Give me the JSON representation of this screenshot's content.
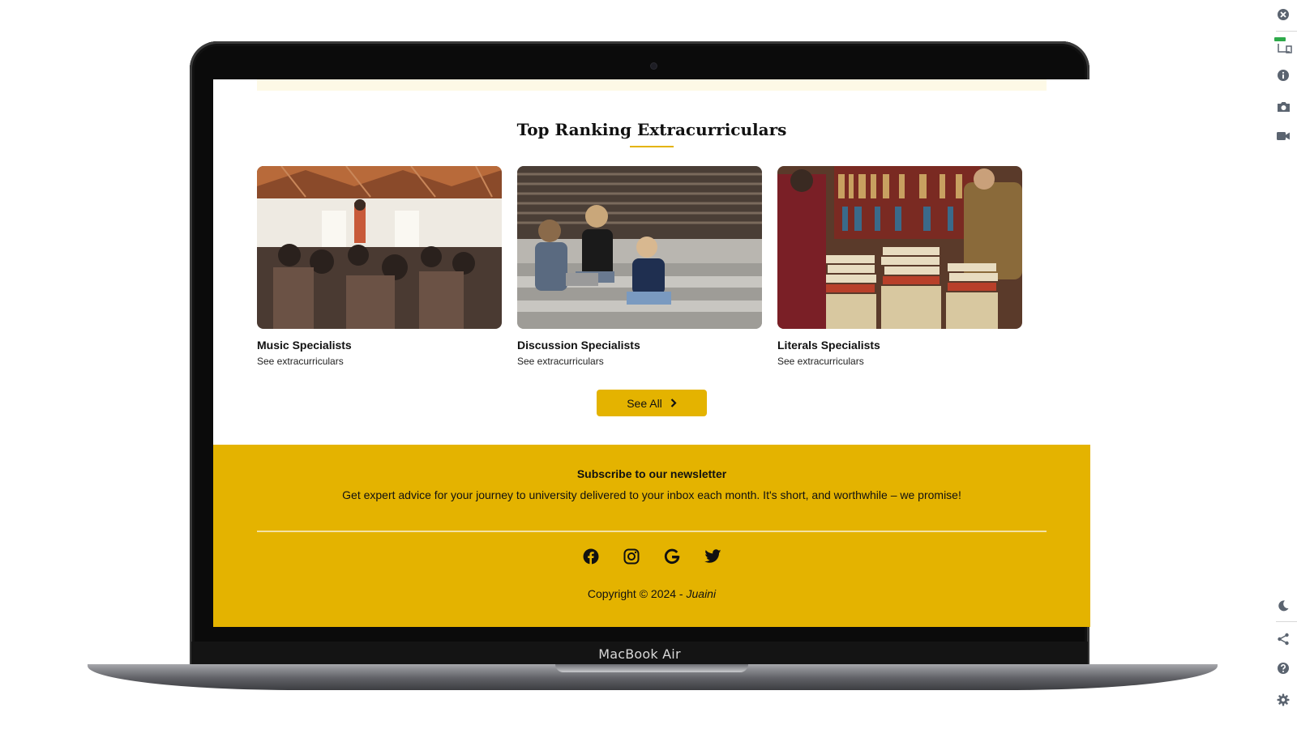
{
  "device": {
    "label": "MacBook Air"
  },
  "section": {
    "title": "Top Ranking Extracurriculars",
    "cards": [
      {
        "title": "Music Specialists",
        "link": "See extracurriculars",
        "image": "students-in-study-hall"
      },
      {
        "title": "Discussion Specialists",
        "link": "See extracurriculars",
        "image": "students-talking-on-stairs"
      },
      {
        "title": "Literals Specialists",
        "link": "See extracurriculars",
        "image": "book-stall"
      }
    ],
    "see_all": {
      "label": "See All",
      "icon": "chevron-right-icon"
    }
  },
  "newsletter": {
    "title": "Subscribe to our newsletter",
    "text": "Get expert advice for your journey to university delivered to your inbox each month. It's short, and worthwhile – we promise!"
  },
  "footer": {
    "socials": [
      "facebook-icon",
      "instagram-icon",
      "google-icon",
      "twitter-icon"
    ],
    "copyright_prefix": "Copyright © 2024 - ",
    "brand": "Juaini"
  },
  "toolbar": {
    "icons": [
      "close-icon",
      "device-icon",
      "info-icon",
      "camera-icon",
      "video-icon",
      "moon-icon",
      "share-icon",
      "help-icon",
      "settings-icon"
    ]
  },
  "colors": {
    "accent": "#e4b300",
    "top_strip": "#fdf9e6",
    "text": "#111111"
  }
}
